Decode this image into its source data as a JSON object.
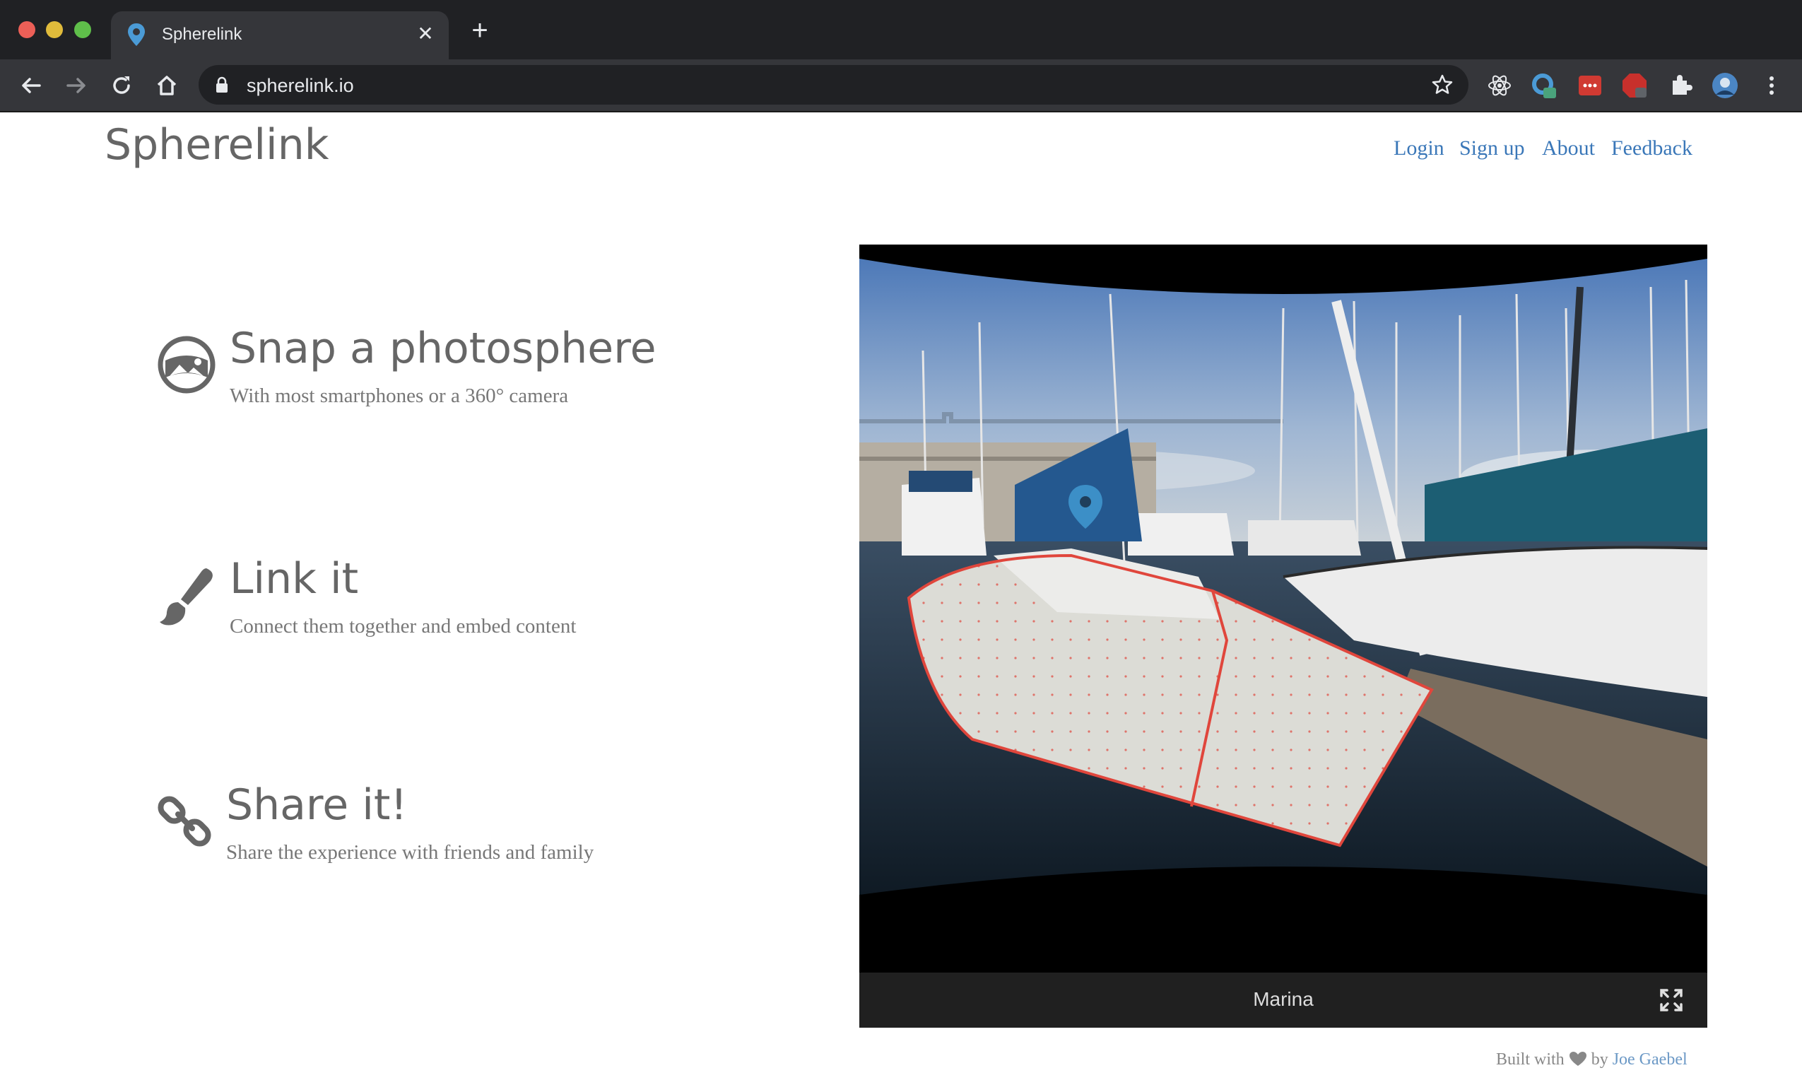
{
  "browser": {
    "tab_title": "Spherelink",
    "url": "spherelink.io"
  },
  "site": {
    "brand": "Spherelink",
    "nav": [
      "Login",
      "Sign up",
      "About",
      "Feedback"
    ]
  },
  "features": [
    {
      "icon": "photosphere-icon",
      "title": "Snap a photosphere",
      "subtitle": "With most smartphones or a 360° camera"
    },
    {
      "icon": "paintbrush-icon",
      "title": "Link it",
      "subtitle": "Connect them together and embed content"
    },
    {
      "icon": "chain-link-icon",
      "title": "Share it!",
      "subtitle": "Share the experience with friends and family"
    }
  ],
  "viewer": {
    "caption": "Marina",
    "accent_marker": "#3c8fc7",
    "outline_color": "#e0463c"
  },
  "footer": {
    "built_with": "Built with",
    "by": "by",
    "author": "Joe Gaebel"
  }
}
